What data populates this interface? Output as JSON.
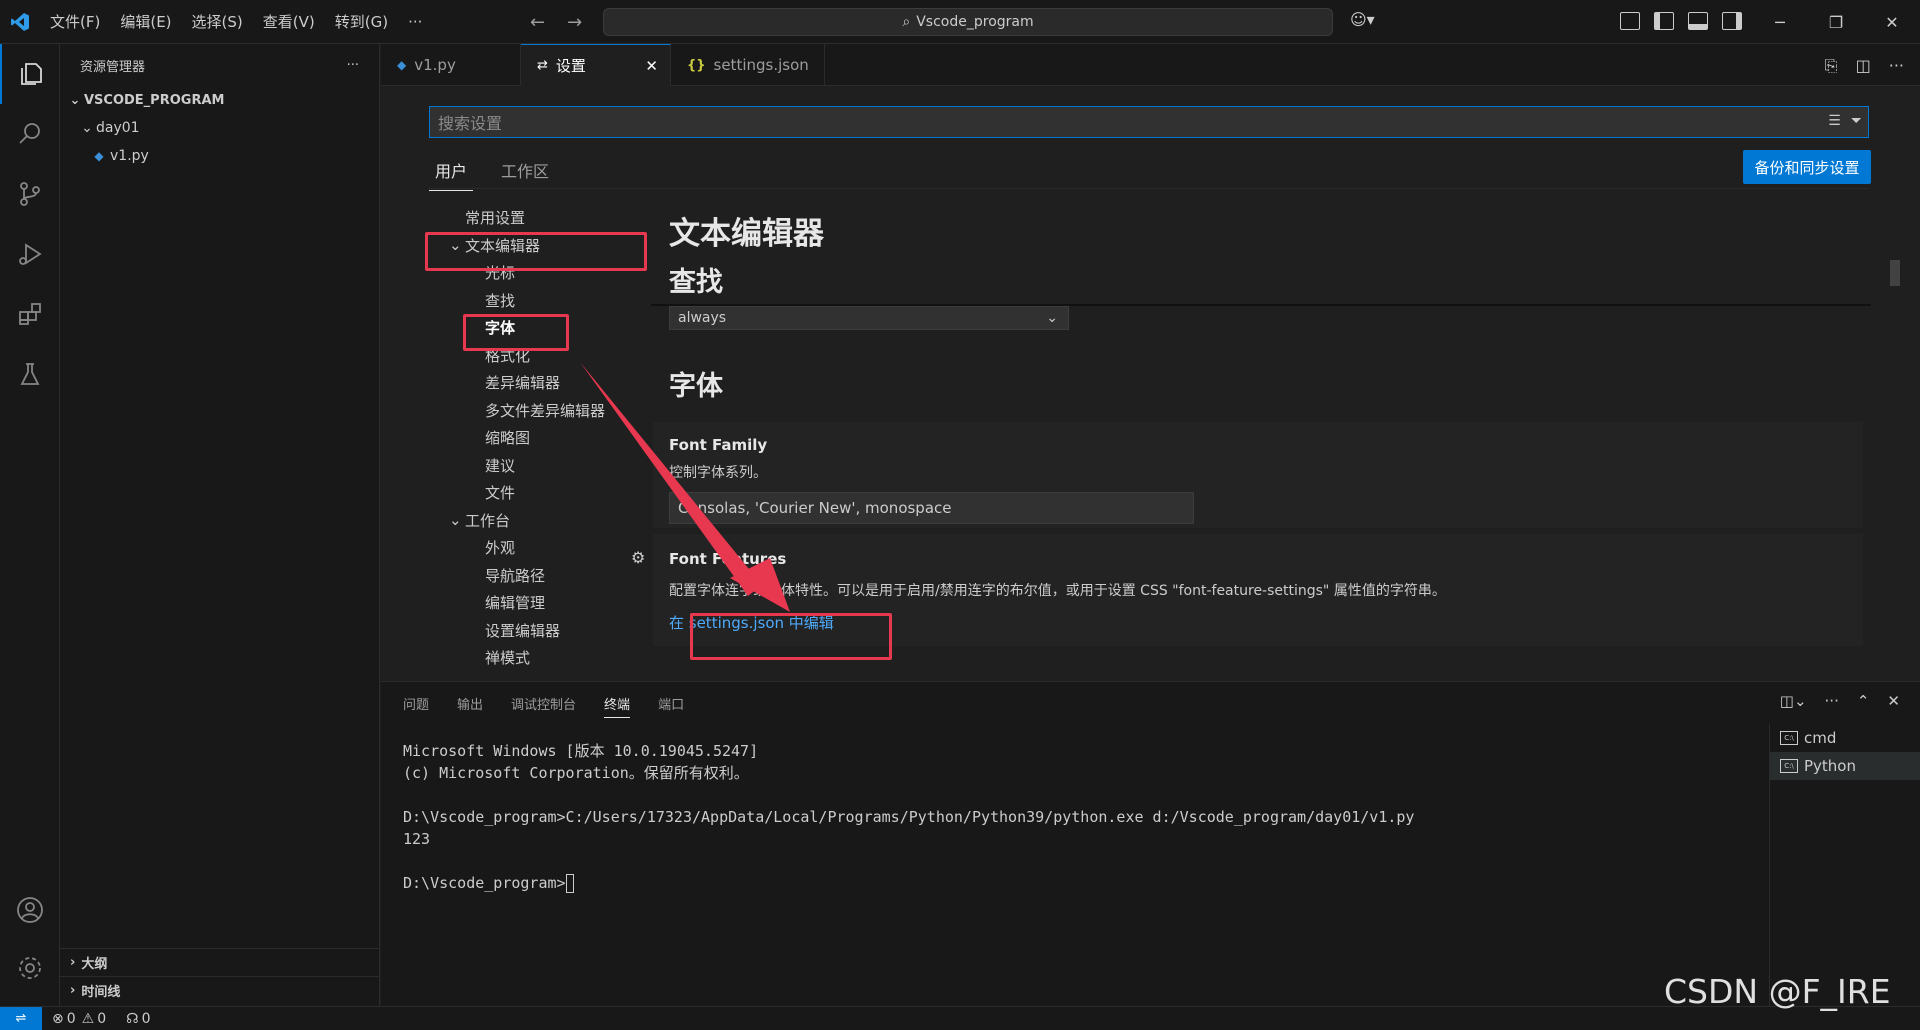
{
  "titlebar": {
    "menus": [
      "文件(F)",
      "编辑(E)",
      "选择(S)",
      "查看(V)",
      "转到(G)"
    ],
    "more": "···",
    "search_text": "Vscode_program"
  },
  "sidebar": {
    "title": "资源管理器",
    "more": "···",
    "root": "VSCODE_PROGRAM",
    "folder": "day01",
    "file": "v1.py",
    "outline": "大纲",
    "timeline": "时间线"
  },
  "tabs": [
    {
      "label": "v1.py"
    },
    {
      "label": "设置"
    },
    {
      "label": "settings.json"
    }
  ],
  "settings": {
    "search_placeholder": "搜索设置",
    "scope_user": "用户",
    "scope_workspace": "工作区",
    "sync_button": "备份和同步设置",
    "toc": {
      "common": "常用设置",
      "text_editor": "文本编辑器",
      "cursor": "光标",
      "find": "查找",
      "font": "字体",
      "format": "格式化",
      "diff_editor": "差异编辑器",
      "multi_diff": "多文件差异编辑器",
      "minimap": "缩略图",
      "suggest": "建议",
      "files": "文件",
      "workbench": "工作台",
      "appearance": "外观",
      "breadcrumbs": "导航路径",
      "editor_management": "编辑管理",
      "settings_editor": "设置编辑器",
      "zen_mode": "禅模式"
    },
    "heading_main": "文本编辑器",
    "heading_find": "查找",
    "dropdown_value": "always",
    "heading_font": "字体",
    "font_family": {
      "title": "Font Family",
      "desc": "控制字体系列。",
      "value": "Consolas, 'Courier New', monospace"
    },
    "font_features": {
      "title": "Font Features",
      "desc": "配置字体连字或字体特性。可以是用于启用/禁用连字的布尔值，或用于设置 CSS \"font-feature-settings\" 属性值的字符串。",
      "link": "在 settings.json 中编辑"
    }
  },
  "panel": {
    "tabs": [
      "问题",
      "输出",
      "调试控制台",
      "终端",
      "端口"
    ],
    "terminal_lines": [
      "Microsoft Windows [版本 10.0.19045.5247]",
      "(c) Microsoft Corporation。保留所有权利。",
      "",
      "D:\\Vscode_program>C:/Users/17323/AppData/Local/Programs/Python/Python39/python.exe d:/Vscode_program/day01/v1.py",
      "123",
      "",
      "D:\\Vscode_program>"
    ],
    "terminals": [
      "cmd",
      "Python"
    ]
  },
  "statusbar": {
    "errors": "0",
    "warnings": "0",
    "ports": "0"
  },
  "watermark": "CSDN @F_IRE",
  "colors": {
    "accent": "#0078d4",
    "annotation": "#e8384f",
    "link": "#4daafc"
  }
}
